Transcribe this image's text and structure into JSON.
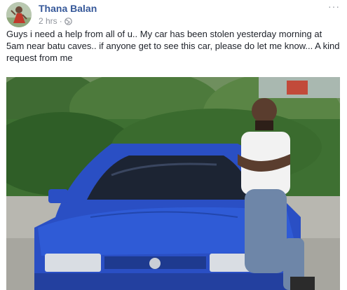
{
  "post": {
    "author": "Thana Balan",
    "time": "2 hrs",
    "separator": "·",
    "menu": "···",
    "message": "Guys i need a help from all of u.. My car has been stolen yesterday morning at 5am near batu caves.. if anyone get to see this car, please do let me know... A kind request from me"
  },
  "colors": {
    "author_link": "#365899",
    "meta_text": "#90949c",
    "car_blue": "#2a4fc4"
  },
  "icons": {
    "privacy": "globe-icon",
    "options": "more-options-icon"
  }
}
